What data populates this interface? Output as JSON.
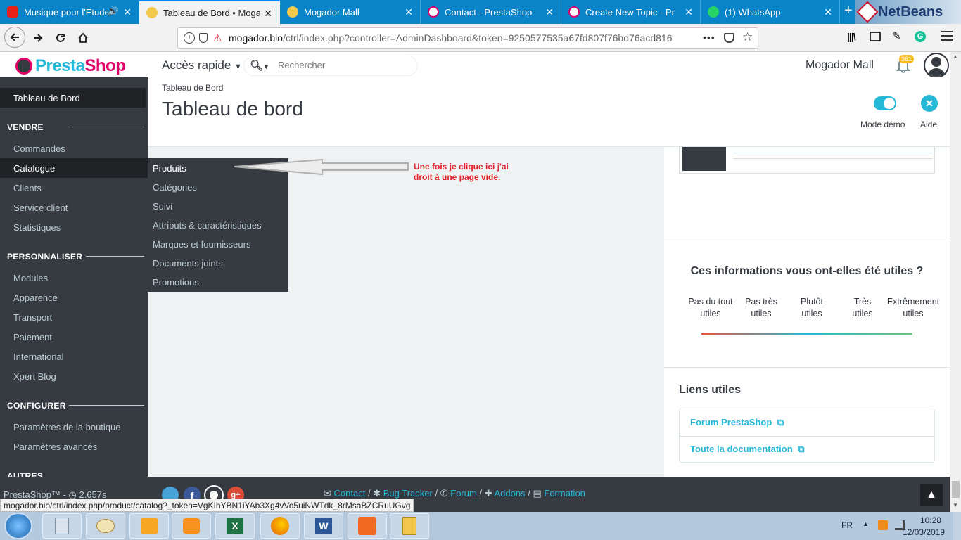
{
  "browser": {
    "tabs": [
      {
        "label": "Musique pour l'Etude",
        "active": false
      },
      {
        "label": "Tableau de Bord • Mogador",
        "active": true
      },
      {
        "label": "Mogador Mall",
        "active": false
      },
      {
        "label": "Contact - PrestaShop",
        "active": false
      },
      {
        "label": "Create New Topic - Presta",
        "active": false
      },
      {
        "label": "(1) WhatsApp",
        "active": false
      }
    ],
    "url_host": "mogador.bio",
    "url_rest": "/ctrl/index.php?controller=AdminDashboard&token=9250577535a67fd807f76bd76acd816",
    "more_dots": "•••",
    "status_url": "mogador.bio/ctrl/index.php/product/catalog?_token=VgKIhYBN1iYAb3Xg4vVo5uiNWTdk_8rMsaBZCRuUGvg",
    "netbeans_label": "NetBeans"
  },
  "header": {
    "logo_presta": "Presta",
    "logo_shop": "Shop",
    "quick_access": "Accès rapide",
    "search_placeholder": "Rechercher",
    "shop_name": "Mogador Mall",
    "notif_count": "361"
  },
  "sidebar": {
    "dashboard": "Tableau de Bord",
    "sections": [
      {
        "title": "VENDRE",
        "items": [
          "Commandes",
          "Catalogue",
          "Clients",
          "Service client",
          "Statistiques"
        ]
      },
      {
        "title": "PERSONNALISER",
        "items": [
          "Modules",
          "Apparence",
          "Transport",
          "Paiement",
          "International",
          "Xpert Blog"
        ]
      },
      {
        "title": "CONFIGURER",
        "items": [
          "Paramètres de la boutique",
          "Paramètres avancés"
        ]
      },
      {
        "title": "AUTRES",
        "items": []
      }
    ]
  },
  "submenu": {
    "items": [
      "Produits",
      "Catégories",
      "Suivi",
      "Attributs & caractéristiques",
      "Marques et fournisseurs",
      "Documents joints",
      "Promotions"
    ]
  },
  "annotation": {
    "line1": "Une fois je clique ici j'ai",
    "line2": "droit à une page vide."
  },
  "page": {
    "breadcrumb": "Tableau de Bord",
    "title": "Tableau de bord",
    "demo_mode_label": "Mode démo",
    "help_label": "Aide"
  },
  "feedback": {
    "question": "Ces informations vous ont-elles été utiles ?",
    "options": [
      {
        "l1": "Pas du tout",
        "l2": "utiles"
      },
      {
        "l1": "Pas très",
        "l2": "utiles"
      },
      {
        "l1": "Plutôt",
        "l2": "utiles"
      },
      {
        "l1": "Très",
        "l2": "utiles"
      },
      {
        "l1": "Extrêmement",
        "l2": "utiles"
      }
    ]
  },
  "links": {
    "title": "Liens utiles",
    "forum": "Forum PrestaShop",
    "docs": "Toute la documentation"
  },
  "footer": {
    "version": "PrestaShop™ - ",
    "time": "2.657s",
    "contact": "Contact",
    "bug_tracker": "Bug Tracker",
    "forum": "Forum",
    "addons": "Addons",
    "formation": "Formation",
    "separator": "/"
  },
  "taskbar": {
    "lang": "FR",
    "time": "10:28",
    "date": "12/03/2019"
  },
  "colors": {
    "browser_tabbar": "#0a84c9",
    "sidebar_bg": "#363a41",
    "accent": "#25b9d7",
    "annotation_red": "#e0202b"
  }
}
